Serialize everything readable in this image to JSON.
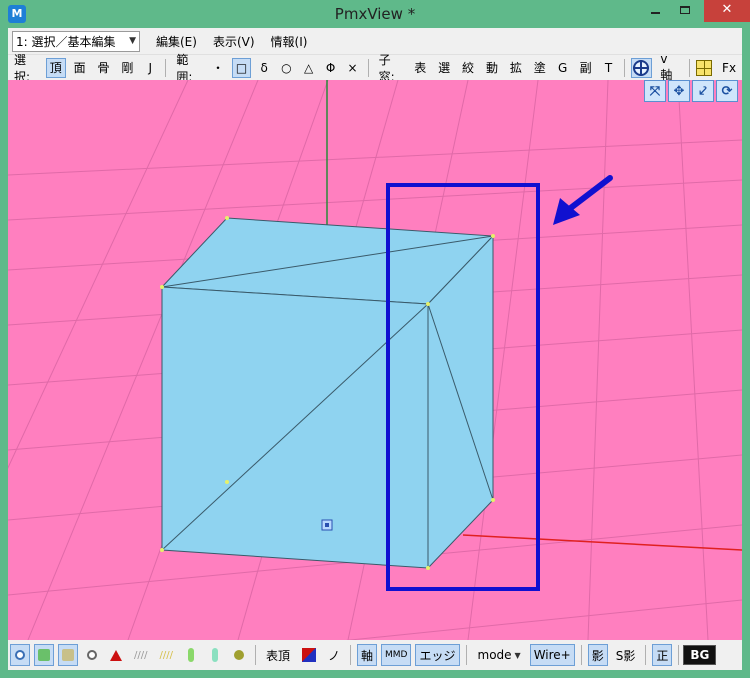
{
  "window": {
    "title": "PmxView *",
    "app_icon": "pmx-icon",
    "controls": [
      "minimize",
      "maximize",
      "close"
    ],
    "close_glyph": "✕"
  },
  "menubar": {
    "mode_select": "1: 選択／基本編集",
    "items": [
      "編集(E)",
      "表示(V)",
      "情報(I)"
    ]
  },
  "toolbar": {
    "select_label": "選択:",
    "select_items": [
      "頂",
      "面",
      "骨",
      "剛",
      "J"
    ],
    "range_label": "範囲:",
    "range_items": [
      "・",
      "□",
      "δ",
      "○",
      "△",
      "Φ",
      "×"
    ],
    "child_label": "子窓:",
    "child_items": [
      "表",
      "選",
      "絞",
      "動",
      "拡",
      "塗",
      "G",
      "副",
      "T"
    ],
    "vaxis_label": "v軸",
    "fx_label": "Fx"
  },
  "nav_tools": [
    "⤧",
    "✥",
    "⤦",
    "⟳"
  ],
  "bottombar": {
    "surface_vertex": "表頂",
    "no_label": "ノ",
    "axis": "軸",
    "mmd": "MMD",
    "edge": "エッジ",
    "mode": "mode",
    "wire": "Wire+",
    "shadow": "影",
    "sshadow": "S影",
    "ortho": "正",
    "bg": "BG"
  },
  "colors": {
    "viewport_bg": "#ff7fbf",
    "cube_face": "#8fd3f0",
    "annotation": "#1010d0",
    "grid_line": "#e06aa8",
    "y_axis": "#2a8a3a",
    "x_axis": "#e02020"
  }
}
